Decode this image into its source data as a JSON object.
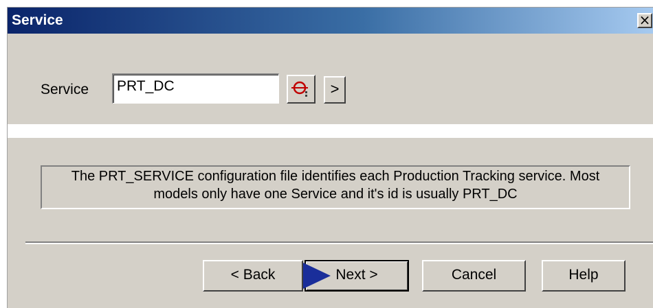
{
  "window": {
    "title": "Service",
    "close_label": "×"
  },
  "service": {
    "label": "Service",
    "value": "PRT_DC",
    "arrow_label": ">"
  },
  "info": {
    "line1": "The PRT_SERVICE configuration file identifies each Production Tracking service.  Most",
    "line2": "models only have one Service and it's id is usually PRT_DC"
  },
  "buttons": {
    "back": "< Back",
    "next": "Next >",
    "cancel": "Cancel",
    "help": "Help"
  },
  "icons": {
    "lookup": "search-lookup-icon",
    "play": "play-arrow-icon"
  },
  "colors": {
    "title_gradient_start": "#0a246a",
    "title_gradient_end": "#a6caf0",
    "dialog_face": "#d4d0c8",
    "lookup_icon": "#c00000",
    "play_icon": "#1a2e9a"
  }
}
